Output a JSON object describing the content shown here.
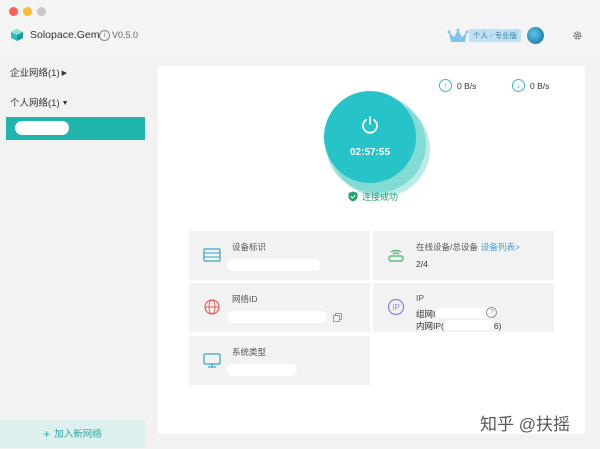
{
  "window": {
    "app_name": "Solopace.Gem",
    "version": "V0.5.0",
    "edition_badge": "个人 - 专业版"
  },
  "sidebar": {
    "groups": [
      {
        "label": "企业网络(1)",
        "expanded": false
      },
      {
        "label": "个人网络(1)",
        "expanded": true
      }
    ],
    "add_network_label": "加入新网络"
  },
  "main": {
    "upload_speed": "0 B/s",
    "download_speed": "0 B/s",
    "timer": "02:57:55",
    "status": "连接成功",
    "cards": {
      "device_id": {
        "label": "设备标识"
      },
      "online": {
        "label": "在线设备/总设备",
        "link": "设备列表>",
        "value": "2/4"
      },
      "network_id": {
        "label": "网络ID"
      },
      "ip": {
        "label": "IP",
        "line1_prefix": "组网I",
        "line2_prefix": "内网IP(",
        "line2_suffix": "6)"
      },
      "system_type": {
        "label": "系统类型"
      }
    }
  },
  "watermark": "知乎 @扶摇",
  "colors": {
    "accent": "#26c3c8",
    "sidebar_selected": "#1fb5ad",
    "status_green": "#26a06b",
    "link_blue": "#3aa0d8"
  }
}
